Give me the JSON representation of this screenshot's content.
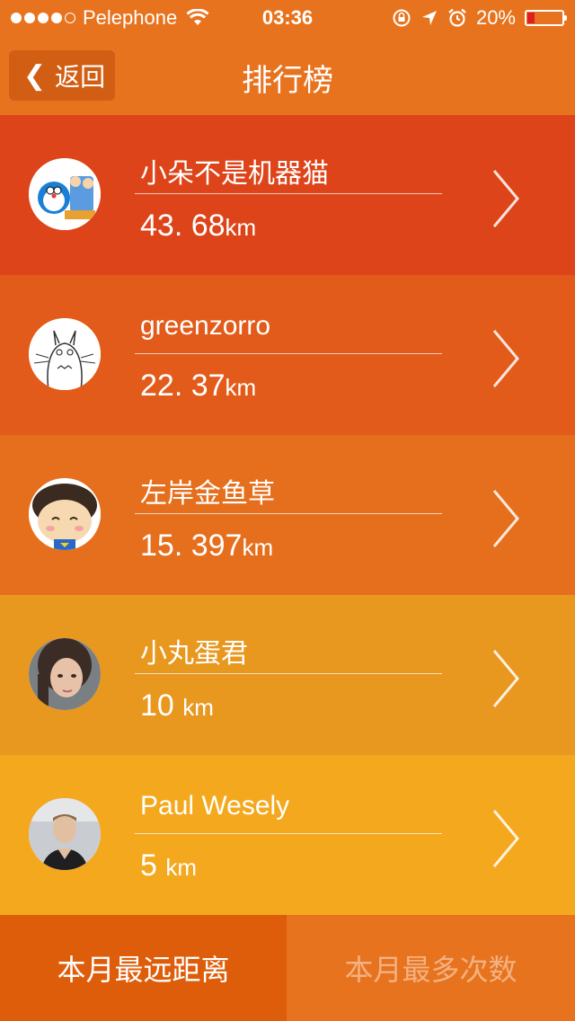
{
  "status_bar": {
    "signal_dots": [
      true,
      true,
      true,
      true,
      false
    ],
    "carrier": "Pelephone",
    "time": "03:36",
    "battery_percent": "20%",
    "battery_level": 0.2
  },
  "nav": {
    "back_label": "返回",
    "title": "排行榜"
  },
  "leaderboard": [
    {
      "name": "小朵不是机器猫",
      "distance": "43. 68",
      "unit": "km",
      "bg": "#de4419",
      "avatar": "doraemon-avatar"
    },
    {
      "name": "greenzorro",
      "distance": "22. 37",
      "unit": "km",
      "bg": "#e25b1a",
      "avatar": "totoro-avatar"
    },
    {
      "name": "左岸金鱼草",
      "distance": "15. 397",
      "unit": "km",
      "bg": "#e56f1d",
      "avatar": "cartoon-girl-avatar"
    },
    {
      "name": "小丸蛋君",
      "distance": "10 ",
      "unit": "km",
      "bg": "#e8971f",
      "avatar": "woman-photo-avatar"
    },
    {
      "name": "Paul Wesely",
      "distance": "5 ",
      "unit": "km",
      "bg": "#f4a81d",
      "avatar": "man-photo-avatar"
    }
  ],
  "tabs": {
    "monthly_distance": "本月最远距离",
    "monthly_count": "本月最多次数"
  },
  "colors": {
    "header": "#e8731e",
    "active_tab": "#de5d0a",
    "battery_low": "#e02020"
  }
}
